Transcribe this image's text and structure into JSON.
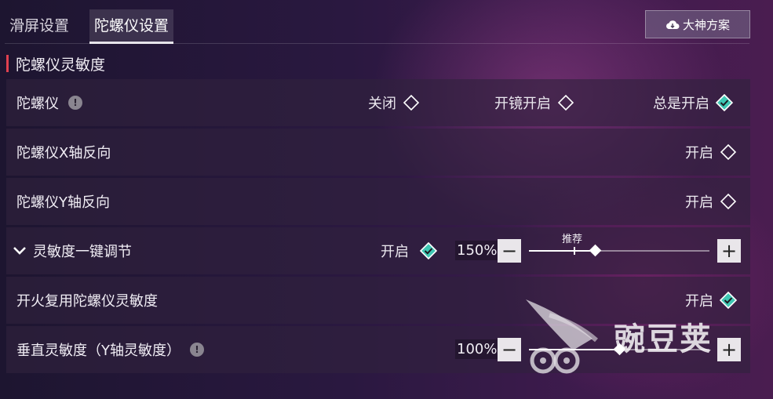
{
  "tabs": [
    {
      "label": "滑屏设置",
      "active": false
    },
    {
      "label": "陀螺仪设置",
      "active": true
    }
  ],
  "preset_button": {
    "label": "大神方案",
    "icon": "cloud-icon"
  },
  "section": {
    "title": "陀螺仪灵敏度"
  },
  "gyro": {
    "label": "陀螺仪",
    "options": [
      {
        "label": "关闭",
        "selected": false
      },
      {
        "label": "开镜开启",
        "selected": false
      },
      {
        "label": "总是开启",
        "selected": true
      }
    ]
  },
  "x_invert": {
    "label": "陀螺仪X轴反向",
    "option": "开启",
    "selected": false
  },
  "y_invert": {
    "label": "陀螺仪Y轴反向",
    "option": "开启",
    "selected": false
  },
  "one_key": {
    "label": "灵敏度一键调节",
    "option": "开启",
    "selected": true,
    "percent": "150%",
    "value": 150,
    "recommended_label": "推荐"
  },
  "fire_reuse": {
    "label": "开火复用陀螺仪灵敏度",
    "option": "开启",
    "selected": true
  },
  "vertical": {
    "label": "垂直灵敏度（Y轴灵敏度）",
    "percent": "100%",
    "value": 100
  },
  "watermark": {
    "text": "豌豆荚"
  },
  "colors": {
    "accent": "#e0414f",
    "selected_diamond": "#3fc7b4"
  }
}
